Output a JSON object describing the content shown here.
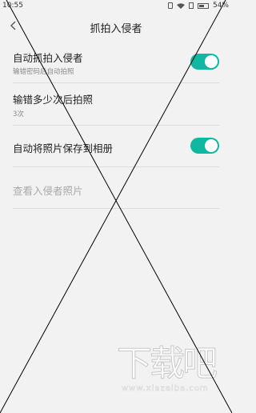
{
  "status_bar": {
    "time": "10:55",
    "battery_percent": "54%",
    "icons": [
      "vibrate-icon",
      "wifi-icon",
      "sim-icon",
      "battery-icon"
    ]
  },
  "header": {
    "title": "抓拍入侵者",
    "back_icon": "back-chevron-icon"
  },
  "settings": {
    "auto_capture": {
      "label": "自动抓拍入侵者",
      "description": "输错密码后自动拍照",
      "enabled": true
    },
    "wrong_attempts": {
      "label": "输错多少次后拍照",
      "value": "3次"
    },
    "save_to_album": {
      "label": "自动将照片保存到相册",
      "enabled": true
    },
    "view_photos": {
      "label": "查看入侵者照片"
    }
  },
  "watermark": {
    "glyphs": "下载吧",
    "url": "www.xiazaiba.com"
  },
  "colors": {
    "accent": "#10b8a2",
    "background": "#f2f2f2",
    "divider": "#dcdcdc"
  }
}
